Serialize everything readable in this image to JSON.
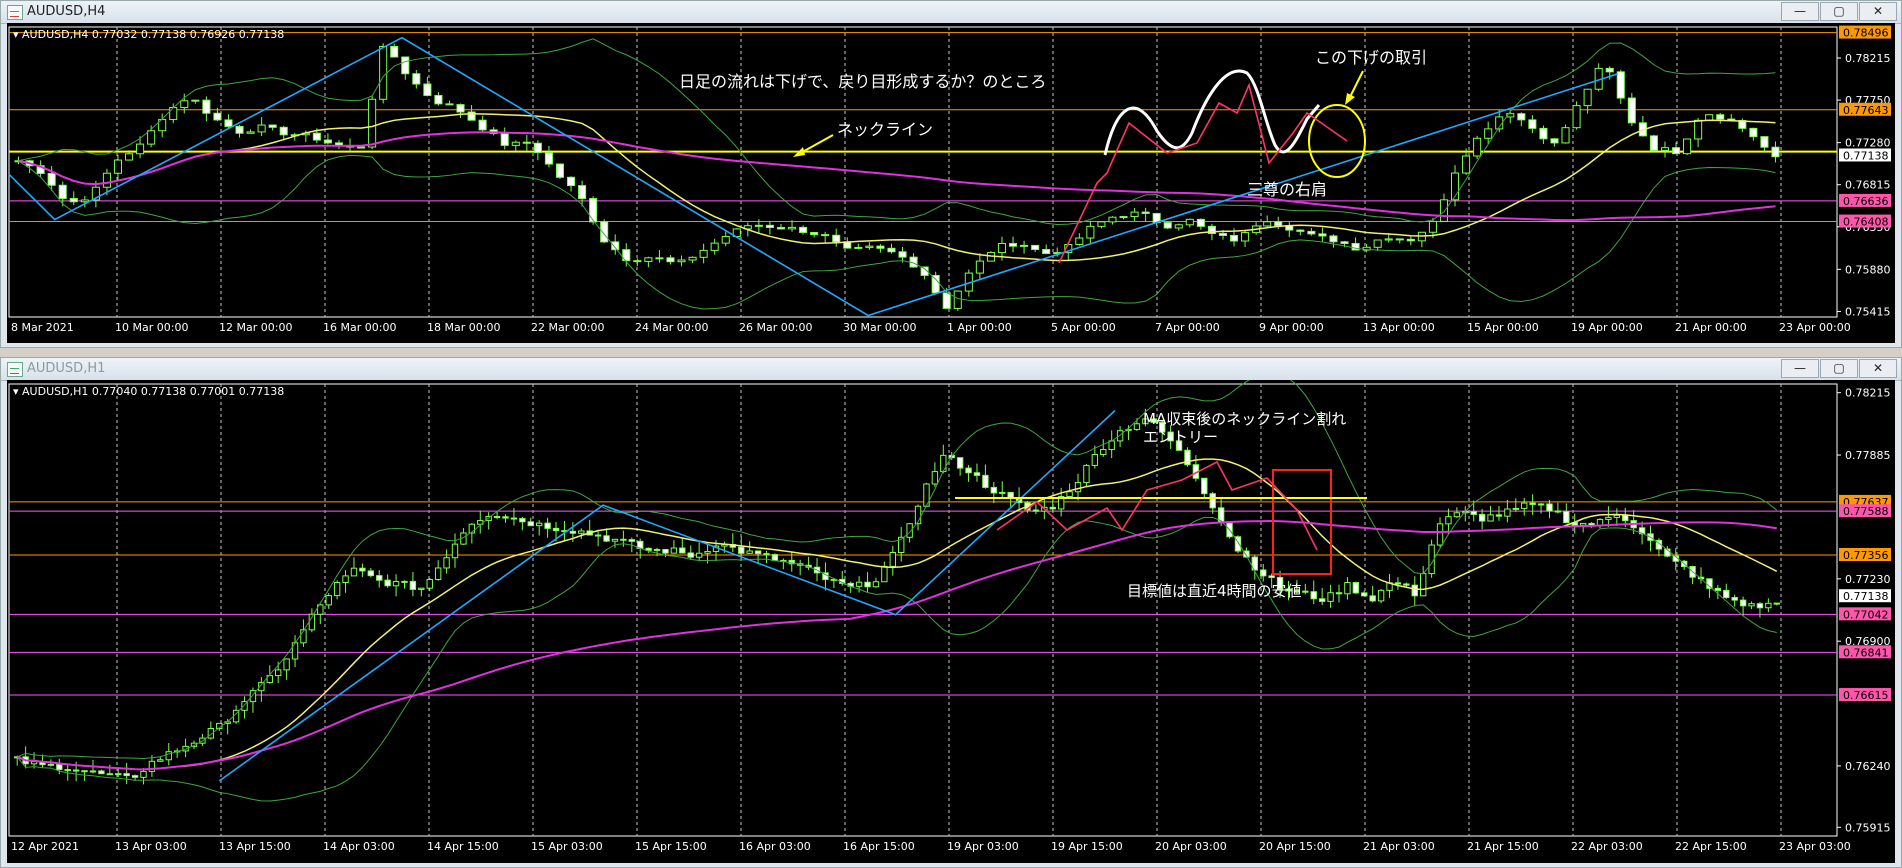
{
  "windows": [
    {
      "title": "AUDUSD,H4",
      "info": "AUDUSD,H4  0.77032 0.77138 0.76926 0.77138",
      "chart_data": {
        "type": "candlestick",
        "symbol": "AUDUSD",
        "timeframe": "H4",
        "ohlc_last": {
          "open": 0.77032,
          "high": 0.77138,
          "low": 0.76926,
          "close": 0.77138
        },
        "ylim": [
          0.75415,
          0.78496
        ],
        "y_ticks": [
          "0.78215",
          "0.77750",
          "0.77280",
          "0.76815",
          "0.76350",
          "0.75880",
          "0.75415"
        ],
        "x_ticks": [
          "8 Mar 2021",
          "10 Mar 00:00",
          "12 Mar 00:00",
          "16 Mar 00:00",
          "18 Mar 00:00",
          "22 Mar 00:00",
          "24 Mar 00:00",
          "26 Mar 00:00",
          "30 Mar 00:00",
          "1 Apr 00:00",
          "5 Apr 00:00",
          "7 Apr 00:00",
          "9 Apr 00:00",
          "13 Apr 00:00",
          "15 Apr 00:00",
          "19 Apr 00:00",
          "21 Apr 00:00",
          "23 Apr 00:00"
        ],
        "price_tags": [
          {
            "value": "0.78496",
            "color": "#ff9900",
            "price": 0.78496
          },
          {
            "value": "0.77643",
            "color": "#ff9900",
            "price": 0.77643
          },
          {
            "value": "0.77138",
            "color": "#ffffff",
            "price": 0.77138
          },
          {
            "value": "0.76636",
            "color": "#ff55aa",
            "price": 0.76636
          },
          {
            "value": "0.76408",
            "color": "#ff55aa",
            "price": 0.76408
          }
        ],
        "hlines": [
          {
            "price": 0.78496,
            "color": "#ff9900"
          },
          {
            "price": 0.77643,
            "color": "#ff9900"
          },
          {
            "price": 0.7718,
            "color": "#ffff00",
            "label_ref": "neckline"
          },
          {
            "price": 0.76636,
            "color": "#ff55ff"
          },
          {
            "price": 0.76408,
            "color": "#ff55ff"
          }
        ],
        "zigzag": [
          {
            "t": 0,
            "p": 0.7693
          },
          {
            "t": 0.025,
            "p": 0.7643
          },
          {
            "t": 0.215,
            "p": 0.7844
          },
          {
            "t": 0.47,
            "p": 0.7537
          },
          {
            "t": 0.88,
            "p": 0.7804
          }
        ],
        "close_path": [
          0.7708,
          0.7695,
          0.766,
          0.767,
          0.7708,
          0.7725,
          0.776,
          0.778,
          0.7755,
          0.774,
          0.7745,
          0.7738,
          0.7735,
          0.7725,
          0.772,
          0.7838,
          0.78,
          0.7775,
          0.7765,
          0.7745,
          0.7725,
          0.7728,
          0.7695,
          0.767,
          0.762,
          0.7598,
          0.7602,
          0.7593,
          0.7608,
          0.7625,
          0.7638,
          0.7635,
          0.7632,
          0.7625,
          0.7608,
          0.7612,
          0.7605,
          0.7588,
          0.7545,
          0.7585,
          0.7612,
          0.7618,
          0.7605,
          0.7612,
          0.7635,
          0.7648,
          0.765,
          0.7636,
          0.7642,
          0.7625,
          0.762,
          0.7645,
          0.7635,
          0.7625,
          0.762,
          0.761,
          0.7625,
          0.762,
          0.764,
          0.7705,
          0.774,
          0.7765,
          0.7745,
          0.7725,
          0.7775,
          0.7818,
          0.7755,
          0.7722,
          0.7718,
          0.7762,
          0.7755,
          0.7738,
          0.771
        ],
        "annotations": [
          "日足の流れは下げで、戻り目形成するか？のところ",
          "ネックライン",
          "この下げの取引",
          "三尊の右肩"
        ]
      }
    },
    {
      "title": "AUDUSD,H1",
      "info": "AUDUSD,H1  0.77040 0.77138 0.77001 0.77138",
      "chart_data": {
        "type": "candlestick",
        "symbol": "AUDUSD",
        "timeframe": "H1",
        "ohlc_last": {
          "open": 0.7704,
          "high": 0.77138,
          "low": 0.77001,
          "close": 0.77138
        },
        "ylim": [
          0.75915,
          0.78215
        ],
        "y_ticks": [
          "0.78215",
          "0.77885",
          "0.77230",
          "0.76900",
          "0.76240",
          "0.75915"
        ],
        "x_ticks": [
          "12 Apr 2021",
          "13 Apr 03:00",
          "13 Apr 15:00",
          "14 Apr 03:00",
          "14 Apr 15:00",
          "15 Apr 03:00",
          "15 Apr 15:00",
          "16 Apr 03:00",
          "16 Apr 15:00",
          "19 Apr 03:00",
          "19 Apr 15:00",
          "20 Apr 03:00",
          "20 Apr 15:00",
          "21 Apr 03:00",
          "21 Apr 15:00",
          "22 Apr 03:00",
          "22 Apr 15:00",
          "23 Apr 03:00"
        ],
        "price_tags": [
          {
            "value": "0.77637",
            "color": "#ff9900",
            "price": 0.77637
          },
          {
            "value": "0.77588",
            "color": "#ff55aa",
            "price": 0.77588
          },
          {
            "value": "0.77356",
            "color": "#ff9900",
            "price": 0.77356
          },
          {
            "value": "0.77138",
            "color": "#ffffff",
            "price": 0.77138
          },
          {
            "value": "0.77042",
            "color": "#ff55aa",
            "price": 0.77042
          },
          {
            "value": "0.76841",
            "color": "#ff55aa",
            "price": 0.76841
          },
          {
            "value": "0.76615",
            "color": "#ff55aa",
            "price": 0.76615
          }
        ],
        "hlines": [
          {
            "price": 0.77637,
            "color": "#ff9900"
          },
          {
            "price": 0.77588,
            "color": "#ff55ff"
          },
          {
            "price": 0.77356,
            "color": "#ff9900"
          },
          {
            "price": 0.77042,
            "color": "#ff55ff"
          },
          {
            "price": 0.76841,
            "color": "#ff55ff"
          },
          {
            "price": 0.76615,
            "color": "#ff55ff"
          }
        ],
        "zigzag": [
          {
            "t": 0.115,
            "p": 0.7616
          },
          {
            "t": 0.325,
            "p": 0.7762
          },
          {
            "t": 0.485,
            "p": 0.7704
          },
          {
            "t": 0.605,
            "p": 0.7812
          }
        ],
        "close_path": [
          0.7627,
          0.7624,
          0.7624,
          0.7621,
          0.7619,
          0.7617,
          0.7626,
          0.7632,
          0.7638,
          0.7645,
          0.7658,
          0.7668,
          0.7682,
          0.7702,
          0.7718,
          0.7728,
          0.7722,
          0.772,
          0.7718,
          0.7735,
          0.7752,
          0.7758,
          0.7755,
          0.7752,
          0.775,
          0.7748,
          0.7745,
          0.7742,
          0.7738,
          0.7738,
          0.7735,
          0.7742,
          0.7738,
          0.7735,
          0.7732,
          0.7728,
          0.7722,
          0.7718,
          0.7722,
          0.7738,
          0.7765,
          0.7788,
          0.7782,
          0.7772,
          0.7765,
          0.7758,
          0.7762,
          0.7775,
          0.7792,
          0.7802,
          0.7808,
          0.7798,
          0.7782,
          0.7762,
          0.774,
          0.7728,
          0.7718,
          0.7715,
          0.7712,
          0.772,
          0.7712,
          0.7722,
          0.7715,
          0.7752,
          0.7758,
          0.7755,
          0.7758,
          0.7762,
          0.776,
          0.7752,
          0.7752,
          0.7758,
          0.7748,
          0.7735,
          0.7728,
          0.7718,
          0.7712,
          0.7708,
          0.771
        ],
        "annotations": [
          "MA収束後のネックライン割れ",
          "エントリー",
          "目標値は直近4時間の安値"
        ]
      }
    }
  ],
  "window_buttons": {
    "minimize": "—",
    "maximize": "▢",
    "close": "✕"
  }
}
